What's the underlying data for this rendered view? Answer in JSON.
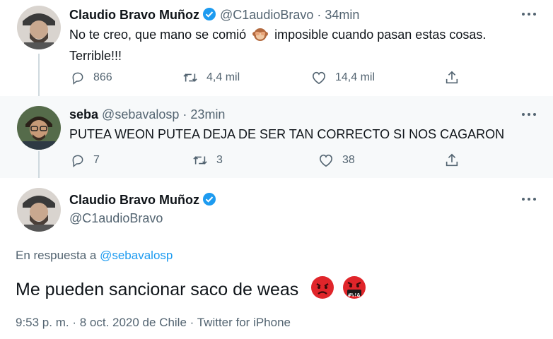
{
  "tweets": [
    {
      "name": "Claudio Bravo Muñoz",
      "handle": "@C1audioBravo",
      "separator": "·",
      "time": "34min",
      "text_line1_part1": "No te creo, que mano se comió",
      "text_line1_part2": "imposible cuando pasan estas cosas.",
      "text_line2": "Terrible!!!",
      "replies": "866",
      "retweets": "4,4 mil",
      "likes": "14,4 mil"
    },
    {
      "name": "seba",
      "handle": "@sebavalosp",
      "separator": "·",
      "time": "23min",
      "text": "PUTEA WEON PUTEA DEJA DE SER TAN CORRECTO SI NOS CAGARON",
      "replies": "7",
      "retweets": "3",
      "likes": "38"
    }
  ],
  "focused": {
    "name": "Claudio Bravo Muñoz",
    "handle": "@C1audioBravo",
    "reply_prefix": "En respuesta a",
    "reply_handle": "@sebavalosp",
    "text": "Me pueden sancionar saco de weas",
    "emoji_text": "#%!&",
    "timestamp": "9:53 p. m. · 8 oct. 2020 de Chile · Twitter for iPhone"
  },
  "colors": {
    "accent": "#1d9bf0",
    "secondary_text": "#536471",
    "highlight_bg": "#f7f9fa"
  },
  "icons": [
    "verified-badge-icon",
    "more-options-icon",
    "reply-icon",
    "retweet-icon",
    "like-icon",
    "share-icon",
    "see-no-evil-monkey-emoji",
    "angry-face-emoji",
    "cursing-face-emoji"
  ]
}
